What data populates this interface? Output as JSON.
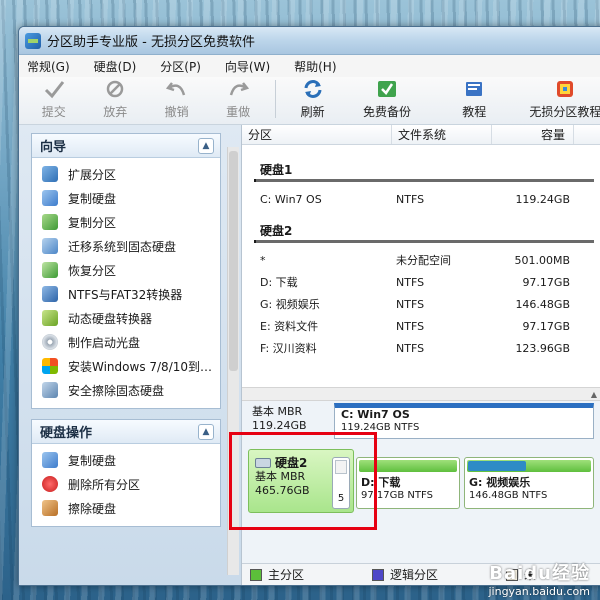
{
  "window": {
    "title": "分区助手专业版 - 无损分区免费软件"
  },
  "menubar": [
    "常规(G)",
    "硬盘(D)",
    "分区(P)",
    "向导(W)",
    "帮助(H)"
  ],
  "toolbar": {
    "commit": "提交",
    "discard": "放弃",
    "undo": "撤销",
    "redo": "重做",
    "refresh": "刷新",
    "free_backup": "免费备份",
    "tutorial": "教程",
    "lossless_tutorial": "无损分区教程"
  },
  "sidebar": {
    "wizard_title": "向导",
    "wizard_items": [
      "扩展分区",
      "复制硬盘",
      "复制分区",
      "迁移系统到固态硬盘",
      "恢复分区",
      "NTFS与FAT32转换器",
      "动态硬盘转换器",
      "制作启动光盘",
      "安装Windows 7/8/10到…",
      "安全擦除固态硬盘"
    ],
    "disk_ops_title": "硬盘操作",
    "disk_ops_items": [
      "复制硬盘",
      "删除所有分区",
      "擦除硬盘"
    ]
  },
  "table": {
    "headers": [
      "分区",
      "文件系统",
      "容量"
    ],
    "groups": [
      {
        "title": "硬盘1",
        "rows": [
          {
            "part": "C: Win7 OS",
            "fs": "NTFS",
            "cap": "119.24GB"
          }
        ]
      },
      {
        "title": "硬盘2",
        "rows": [
          {
            "part": "*",
            "fs": "未分配空间",
            "cap": "501.00MB"
          },
          {
            "part": "D: 下载",
            "fs": "NTFS",
            "cap": "97.17GB"
          },
          {
            "part": "G: 视频娱乐",
            "fs": "NTFS",
            "cap": "146.48GB"
          },
          {
            "part": "E: 资料文件",
            "fs": "NTFS",
            "cap": "97.17GB"
          },
          {
            "part": "F: 汉川资料",
            "fs": "NTFS",
            "cap": "123.96GB"
          }
        ]
      }
    ]
  },
  "diskmap": {
    "disk1_type": "基本 MBR",
    "disk1_size": "119.24GB",
    "disk1_part_name": "C: Win7 OS",
    "disk1_part_info": "119.24GB NTFS",
    "disk2_name": "硬盘2",
    "disk2_type": "基本 MBR",
    "disk2_size": "465.76GB",
    "mini_part_count": "5",
    "part_d_name": "D: 下载",
    "part_d_info": "97.17GB NTFS",
    "part_g_name": "G: 视频娱乐",
    "part_g_info": "146.48GB NTFS"
  },
  "legend": {
    "primary": "主分区",
    "logical": "逻辑分区",
    "unalloc": "未"
  },
  "colors": {
    "primary": "#5cbf3a",
    "logical": "#4e47c8",
    "unalloc": "#f4efe0",
    "highlight": "#e60012"
  },
  "watermark": {
    "logo": "Baidu经验",
    "url": "jingyan.baidu.com"
  }
}
